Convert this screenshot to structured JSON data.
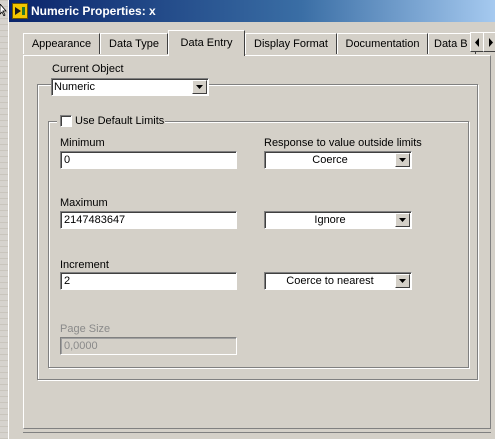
{
  "window": {
    "title": "Numeric Properties: x"
  },
  "tabs": [
    {
      "label": "Appearance"
    },
    {
      "label": "Data Type"
    },
    {
      "label": "Data Entry"
    },
    {
      "label": "Display Format"
    },
    {
      "label": "Documentation"
    },
    {
      "label": "Data B"
    }
  ],
  "active_tab": "Data Entry",
  "current_object": {
    "label": "Current Object",
    "value": "Numeric"
  },
  "use_default_limits": {
    "label": "Use Default Limits",
    "checked": false
  },
  "response_header": "Response to value outside limits",
  "minimum": {
    "label": "Minimum",
    "value": "0",
    "response": "Coerce"
  },
  "maximum": {
    "label": "Maximum",
    "value": "2147483647",
    "response": "Ignore"
  },
  "increment": {
    "label": "Increment",
    "value": "2",
    "response": "Coerce to nearest"
  },
  "page_size": {
    "label": "Page Size",
    "value": "0,0000",
    "enabled": false
  },
  "colors": {
    "titlebar_start": "#0a246a",
    "titlebar_end": "#a6caf0",
    "dialog_face": "#d4d0c8"
  }
}
